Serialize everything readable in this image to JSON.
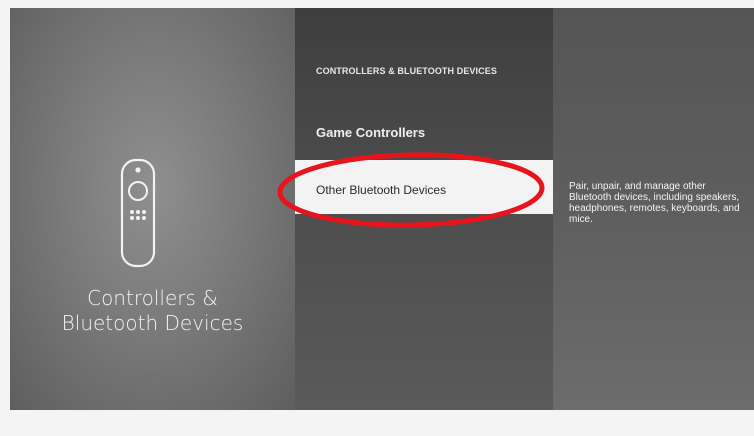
{
  "left_panel": {
    "icon": "fire-tv-remote-icon",
    "title": "Controllers &\nBluetooth Devices"
  },
  "menu": {
    "header": "CONTROLLERS & BLUETOOTH DEVICES",
    "items": [
      {
        "label": "Game Controllers",
        "selected": false
      },
      {
        "label": "Other Bluetooth Devices",
        "selected": true
      }
    ]
  },
  "description": "Pair, unpair, and manage other Bluetooth devices, including speakers, headphones, remotes, keyboards, and mice.",
  "annotation": {
    "shape": "red-ellipse",
    "color": "#e8141c"
  }
}
